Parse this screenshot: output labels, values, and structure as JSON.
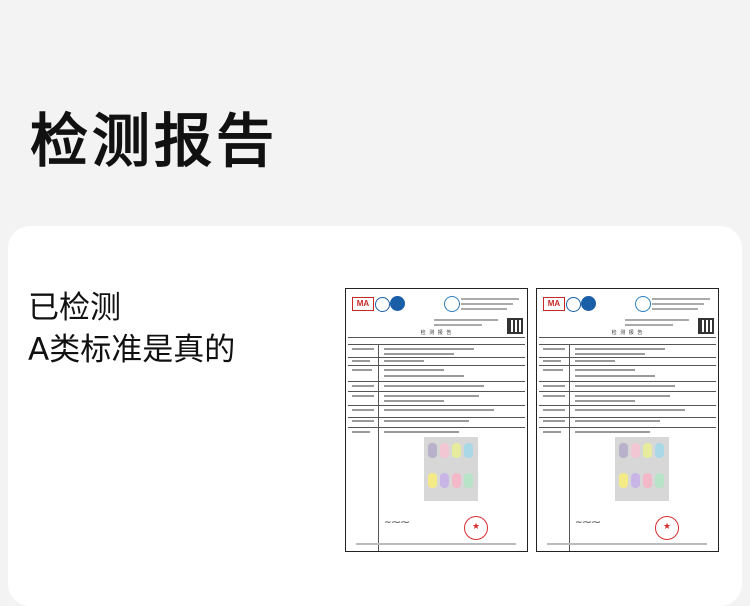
{
  "page": {
    "title": "检测报告",
    "claim_lines": [
      "已检测",
      "A类标准是真的"
    ]
  },
  "reports": [
    {
      "title": "检 测 报 告",
      "sample_colors": [
        "#b9b0c9",
        "#f2c6d2",
        "#e6ec9c",
        "#a9d9e6",
        "#f4ea86",
        "#c9b6e6",
        "#f3b9c9",
        "#b7e3c7"
      ]
    },
    {
      "title": "检 测 报 告",
      "sample_colors": [
        "#b9b0c9",
        "#f2c6d2",
        "#e6ec9c",
        "#a9d9e6",
        "#f4ea86",
        "#c9b6e6",
        "#f3b9c9",
        "#b7e3c7"
      ]
    }
  ],
  "colors": {
    "background": "#f3f3f3",
    "card": "#ffffff",
    "stamp_red": "#d32f2f",
    "cert_blue": "#1a5ea8"
  }
}
